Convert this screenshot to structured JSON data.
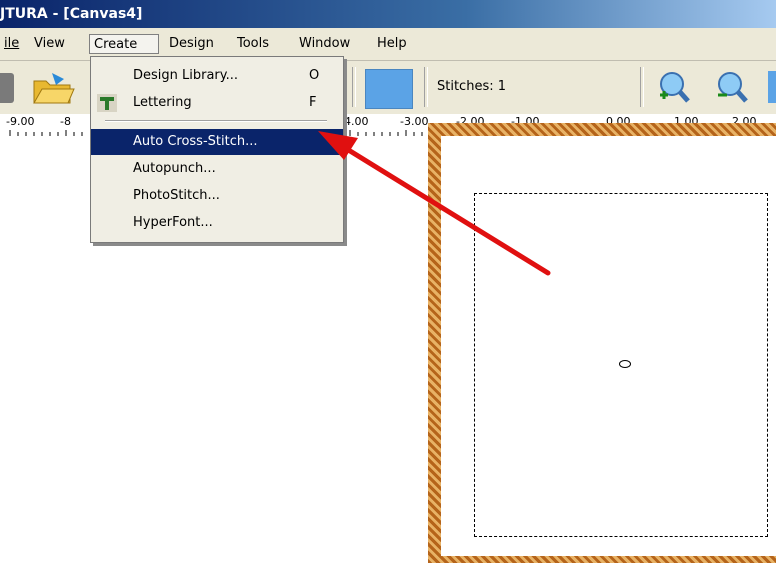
{
  "window": {
    "title": "JTURA - [Canvas4]"
  },
  "menubar": {
    "items": [
      {
        "label": "ile"
      },
      {
        "label": "View"
      },
      {
        "label": "Create"
      },
      {
        "label": "Design"
      },
      {
        "label": "Tools"
      },
      {
        "label": "Window"
      },
      {
        "label": "Help"
      }
    ]
  },
  "toolbar": {
    "stitches": "Stitches: 1",
    "color_swatch": "#5ba3e6"
  },
  "ruler": {
    "labels": [
      "-9.00",
      "-8",
      "4.00",
      "-3.00",
      "-2.00",
      "-1.00",
      "0.00",
      "1.00",
      "2.00"
    ]
  },
  "create_menu": {
    "items": [
      {
        "label": "Design Library...",
        "shortcut": "O"
      },
      {
        "label": "Lettering",
        "shortcut": "F"
      },
      {
        "label": "Auto Cross-Stitch...",
        "shortcut": ""
      },
      {
        "label": "Autopunch...",
        "shortcut": ""
      },
      {
        "label": "PhotoStitch...",
        "shortcut": ""
      },
      {
        "label": "HyperFont...",
        "shortcut": ""
      }
    ],
    "selected_index": 2
  },
  "colors": {
    "accent": "#0a246a",
    "arrow": "#e01010",
    "hoop": "#b5641a"
  }
}
